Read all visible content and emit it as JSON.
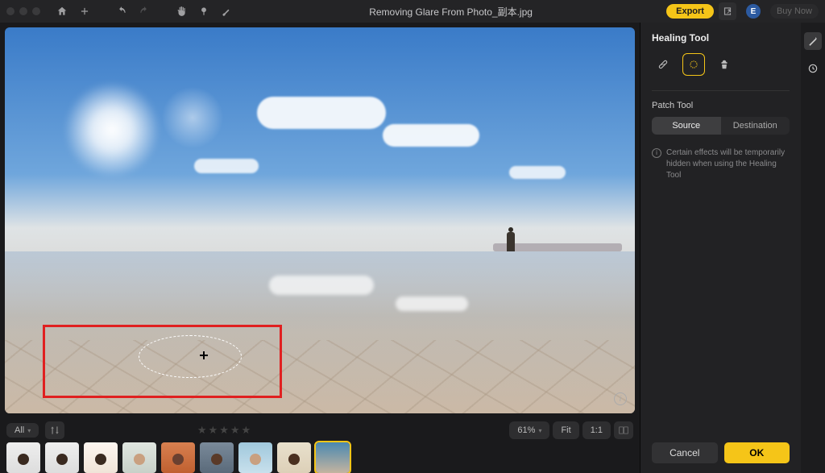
{
  "title": "Removing Glare From Photo_副本.jpg",
  "toolbar": {
    "export_label": "Export",
    "buy_label": "Buy Now",
    "profile_initial": "E"
  },
  "sidebar": {
    "title": "Healing Tool",
    "patch_title": "Patch Tool",
    "segment": {
      "source": "Source",
      "destination": "Destination"
    },
    "note": "Certain effects will be temporarily hidden when using the Healing Tool",
    "cancel": "Cancel",
    "ok": "OK"
  },
  "bottombar": {
    "filter_label": "All",
    "zoom_percent": "61%",
    "fit_label": "Fit",
    "ratio_label": "1:1",
    "star_count": 5
  }
}
